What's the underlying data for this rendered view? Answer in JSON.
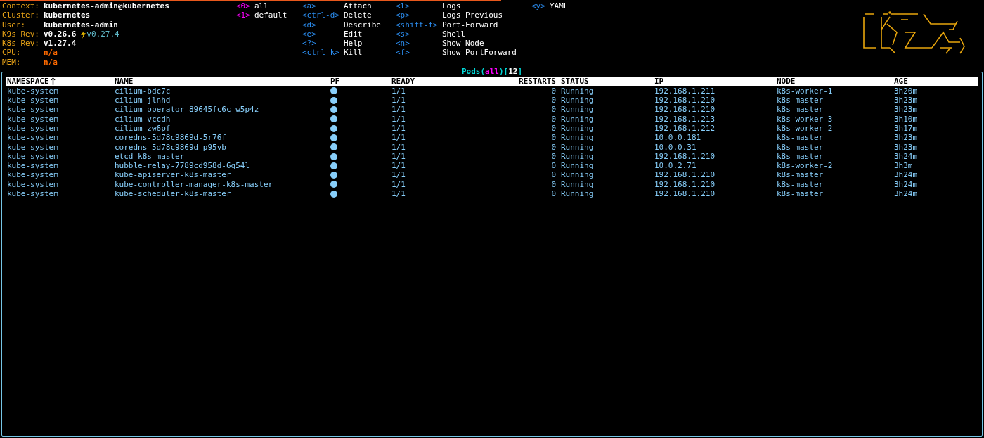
{
  "info": [
    {
      "label": "Context:",
      "value": "kubernetes-admin@kubernetes",
      "kind": "plain"
    },
    {
      "label": "Cluster:",
      "value": "kubernetes",
      "kind": "plain"
    },
    {
      "label": "User:",
      "value": "kubernetes-admin",
      "kind": "plain"
    },
    {
      "label": "K9s Rev:",
      "value": "v0.26.6",
      "kind": "upgrade",
      "upgrade": "v0.27.4"
    },
    {
      "label": "K8s Rev:",
      "value": "v1.27.4",
      "kind": "plain"
    },
    {
      "label": "CPU:",
      "value": "n/a",
      "kind": "metric"
    },
    {
      "label": "MEM:",
      "value": "n/a",
      "kind": "metric"
    }
  ],
  "namespaces": [
    {
      "key": "<0>",
      "label": "all"
    },
    {
      "key": "<1>",
      "label": "default"
    }
  ],
  "actions": [
    [
      {
        "key": "<a>",
        "label": "Attach"
      },
      {
        "key": "<ctrl-d>",
        "label": "Delete"
      },
      {
        "key": "<d>",
        "label": "Describe"
      },
      {
        "key": "<e>",
        "label": "Edit"
      },
      {
        "key": "<?>",
        "label": "Help"
      },
      {
        "key": "<ctrl-k>",
        "label": "Kill"
      }
    ],
    [
      {
        "key": "<l>",
        "label": "Logs"
      },
      {
        "key": "<p>",
        "label": "Logs Previous"
      },
      {
        "key": "<shift-f>",
        "label": "Port-Forward"
      },
      {
        "key": "<s>",
        "label": "Shell"
      },
      {
        "key": "<n>",
        "label": "Show Node"
      },
      {
        "key": "<f>",
        "label": "Show PortForward"
      }
    ],
    [
      {
        "key": "<y>",
        "label": "YAML"
      }
    ]
  ],
  "table": {
    "title": {
      "resource": "Pods",
      "open_paren": "(",
      "namespace": "all",
      "close_paren": ")",
      "count_open": "[",
      "count": "12",
      "count_close": "]"
    },
    "columns": [
      {
        "label": "NAMESPACE",
        "sorted": true
      },
      {
        "label": "NAME",
        "sorted": false
      },
      {
        "label": "PF",
        "sorted": false
      },
      {
        "label": "READY",
        "sorted": false
      },
      {
        "label": "RESTARTS",
        "sorted": false
      },
      {
        "label": "STATUS",
        "sorted": false
      },
      {
        "label": "IP",
        "sorted": false
      },
      {
        "label": "NODE",
        "sorted": false
      },
      {
        "label": "AGE",
        "sorted": false
      }
    ],
    "rows": [
      {
        "namespace": "kube-system",
        "name": "cilium-bdc7c",
        "ready": "1/1",
        "restarts": "0",
        "status": "Running",
        "ip": "192.168.1.211",
        "node": "k8s-worker-1",
        "age": "3h20m"
      },
      {
        "namespace": "kube-system",
        "name": "cilium-jlnhd",
        "ready": "1/1",
        "restarts": "0",
        "status": "Running",
        "ip": "192.168.1.210",
        "node": "k8s-master",
        "age": "3h23m"
      },
      {
        "namespace": "kube-system",
        "name": "cilium-operator-89645fc6c-w5p4z",
        "ready": "1/1",
        "restarts": "0",
        "status": "Running",
        "ip": "192.168.1.210",
        "node": "k8s-master",
        "age": "3h23m"
      },
      {
        "namespace": "kube-system",
        "name": "cilium-vccdh",
        "ready": "1/1",
        "restarts": "0",
        "status": "Running",
        "ip": "192.168.1.213",
        "node": "k8s-worker-3",
        "age": "3h10m"
      },
      {
        "namespace": "kube-system",
        "name": "cilium-zw6pf",
        "ready": "1/1",
        "restarts": "0",
        "status": "Running",
        "ip": "192.168.1.212",
        "node": "k8s-worker-2",
        "age": "3h17m"
      },
      {
        "namespace": "kube-system",
        "name": "coredns-5d78c9869d-5r76f",
        "ready": "1/1",
        "restarts": "0",
        "status": "Running",
        "ip": "10.0.0.181",
        "node": "k8s-master",
        "age": "3h23m"
      },
      {
        "namespace": "kube-system",
        "name": "coredns-5d78c9869d-p95vb",
        "ready": "1/1",
        "restarts": "0",
        "status": "Running",
        "ip": "10.0.0.31",
        "node": "k8s-master",
        "age": "3h23m"
      },
      {
        "namespace": "kube-system",
        "name": "etcd-k8s-master",
        "ready": "1/1",
        "restarts": "0",
        "status": "Running",
        "ip": "192.168.1.210",
        "node": "k8s-master",
        "age": "3h24m"
      },
      {
        "namespace": "kube-system",
        "name": "hubble-relay-7789cd958d-6q54l",
        "ready": "1/1",
        "restarts": "0",
        "status": "Running",
        "ip": "10.0.2.71",
        "node": "k8s-worker-2",
        "age": "3h3m"
      },
      {
        "namespace": "kube-system",
        "name": "kube-apiserver-k8s-master",
        "ready": "1/1",
        "restarts": "0",
        "status": "Running",
        "ip": "192.168.1.210",
        "node": "k8s-master",
        "age": "3h24m"
      },
      {
        "namespace": "kube-system",
        "name": "kube-controller-manager-k8s-master",
        "ready": "1/1",
        "restarts": "0",
        "status": "Running",
        "ip": "192.168.1.210",
        "node": "k8s-master",
        "age": "3h24m"
      },
      {
        "namespace": "kube-system",
        "name": "kube-scheduler-k8s-master",
        "ready": "1/1",
        "restarts": "0",
        "status": "Running",
        "ip": "192.168.1.210",
        "node": "k8s-master",
        "age": "3h24m"
      }
    ]
  }
}
